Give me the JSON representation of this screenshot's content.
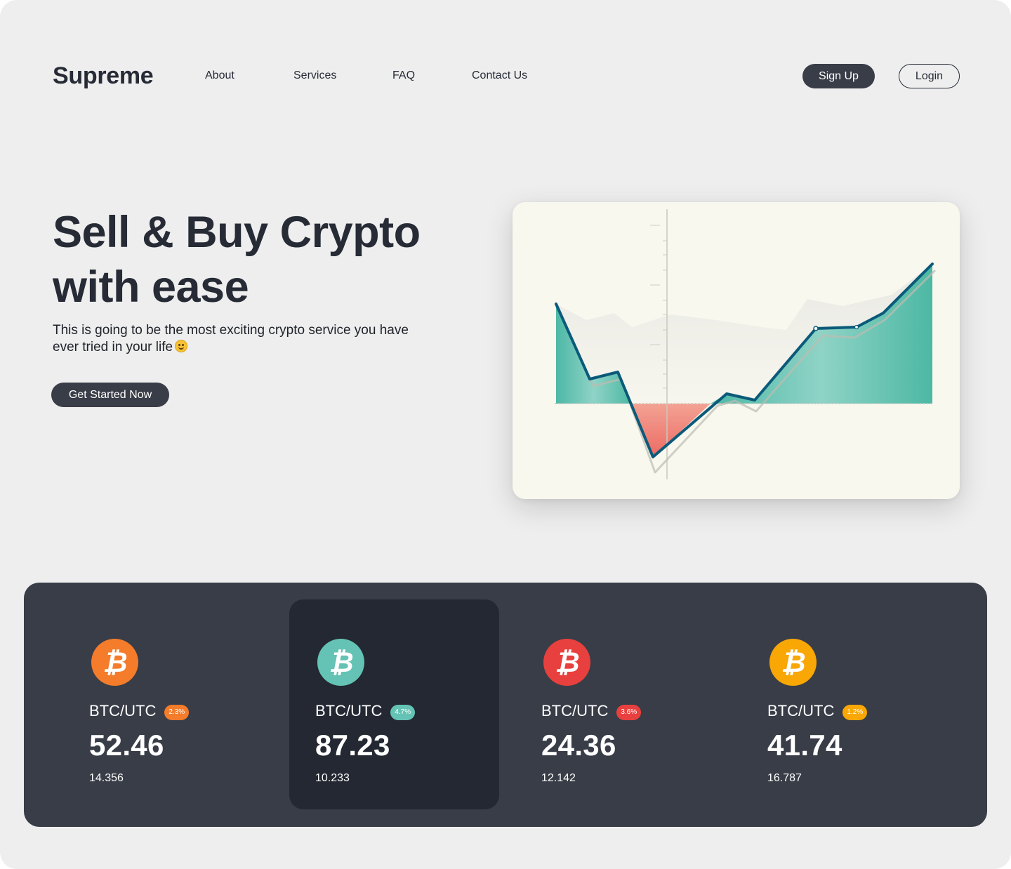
{
  "brand": "Supreme",
  "nav": [
    {
      "label": "About"
    },
    {
      "label": "Services"
    },
    {
      "label": "FAQ"
    },
    {
      "label": "Contact Us"
    }
  ],
  "auth": {
    "signup_label": "Sign Up",
    "login_label": "Login"
  },
  "hero": {
    "title_line1": "Sell & Buy Crypto",
    "title_line2": "with ease",
    "subtitle": "This is going to be the most exciting crypto service you have ever tried in your life",
    "emoji_icon": "smiling-face-icon",
    "cta_label": "Get Started Now"
  },
  "colors": {
    "dark": "#393d47",
    "darker": "#232832",
    "teal": "#5ec2ad",
    "line": "#0b5a7a",
    "negative": "#f08a80",
    "orange": "#f47c2a",
    "red": "#e8403e",
    "yellow": "#f8a705"
  },
  "tickers": [
    {
      "icon": "bitcoin-icon",
      "color": "#f47c2a",
      "pair": "BTC/UTC",
      "change": "2.3%",
      "price": "52.46",
      "volume": "14.356",
      "active": false
    },
    {
      "icon": "bitcoin-icon",
      "color": "#64c3b4",
      "pair": "BTC/UTC",
      "change": "4.7%",
      "price": "87.23",
      "volume": "10.233",
      "active": true
    },
    {
      "icon": "bitcoin-icon",
      "color": "#e8403e",
      "pair": "BTC/UTC",
      "change": "3.6%",
      "price": "24.36",
      "volume": "12.142",
      "active": false
    },
    {
      "icon": "bitcoin-icon",
      "color": "#f8a705",
      "pair": "BTC/UTC",
      "change": "1.2%",
      "price": "41.74",
      "volume": "16.787",
      "active": false
    }
  ]
}
